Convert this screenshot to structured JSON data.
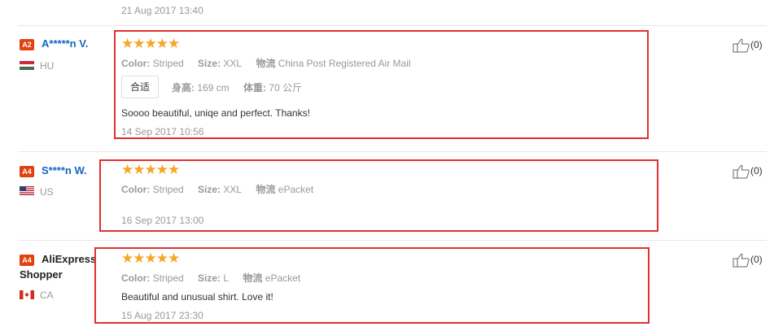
{
  "top_date": "21 Aug 2017 13:40",
  "reviews": [
    {
      "level": "A2",
      "name": "A*****n V.",
      "country": "HU",
      "stars": "★★★★★",
      "color_label": "Color:",
      "color_value": "Striped",
      "size_label": "Size:",
      "size_value": "XXL",
      "logistics_label": "物流",
      "logistics_value": "China Post Registered Air Mail",
      "fit": "合适",
      "height_label": "身高:",
      "height_value": "169 cm",
      "weight_label": "体重:",
      "weight_value": "70 公斤",
      "text": "Soooo beautiful, uniqe and perfect. Thanks!",
      "date": "14 Sep 2017 10:56",
      "likes": "(0)"
    },
    {
      "level": "A4",
      "name": "S****n W.",
      "country": "US",
      "stars": "★★★★★",
      "color_label": "Color:",
      "color_value": "Striped",
      "size_label": "Size:",
      "size_value": "XXL",
      "logistics_label": "物流",
      "logistics_value": "ePacket",
      "date": "16 Sep 2017 13:00",
      "likes": "(0)"
    },
    {
      "level": "A4",
      "name": "AliExpress Shopper",
      "country": "CA",
      "stars": "★★★★★",
      "color_label": "Color:",
      "color_value": "Striped",
      "size_label": "Size:",
      "size_value": "L",
      "logistics_label": "物流",
      "logistics_value": "ePacket",
      "text": "Beautiful and unusual shirt. Love it!",
      "date": "15 Aug 2017 23:30",
      "likes": "(0)"
    }
  ],
  "icons": {
    "like": "thumbs-up-icon",
    "flag_hu": "hungary-flag-icon",
    "flag_us": "usa-flag-icon",
    "flag_ca": "canada-flag-icon"
  },
  "colors": {
    "highlight_box": "#e03030",
    "star": "#f5a623",
    "badge": "#e3410e",
    "name_link": "#1565c0"
  }
}
